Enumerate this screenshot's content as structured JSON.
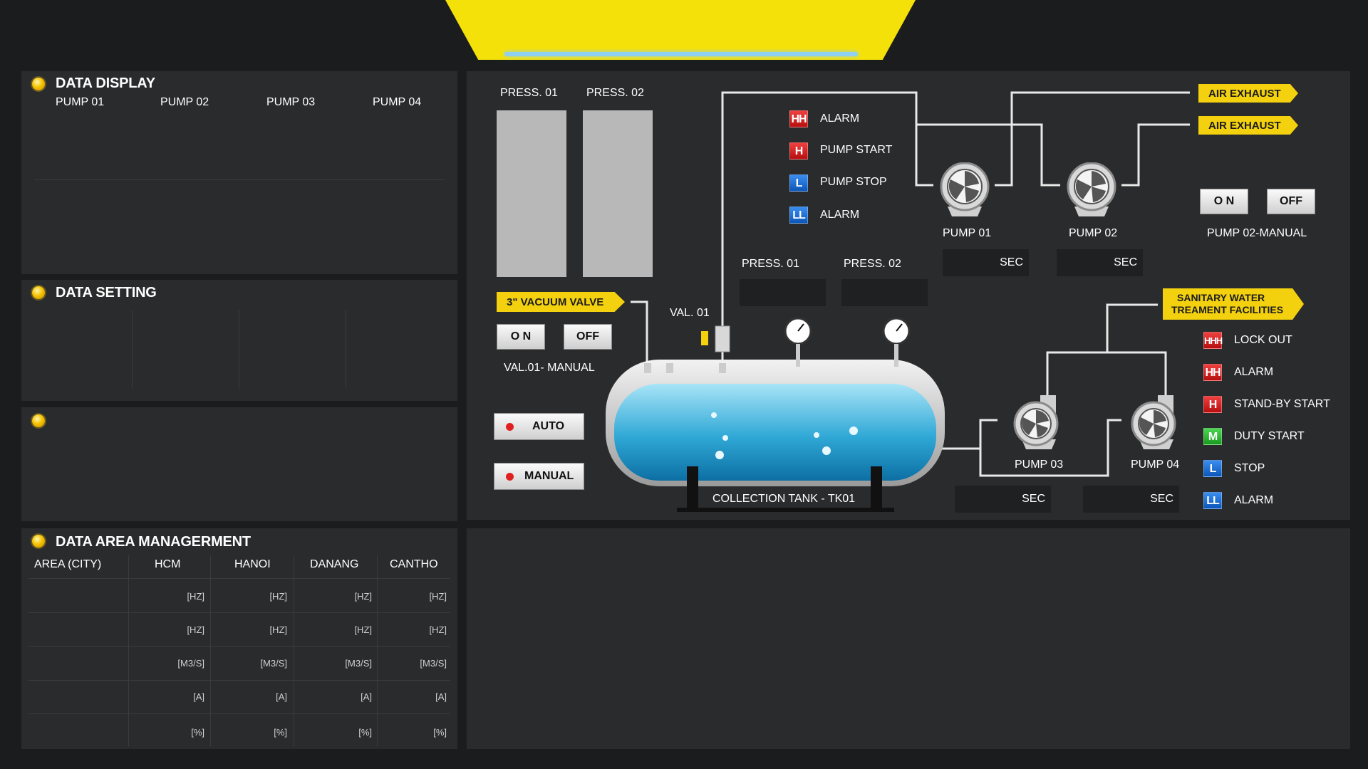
{
  "data_display": {
    "title": "DATA DISPLAY",
    "columns": [
      "PUMP 01",
      "PUMP 02",
      "PUMP 03",
      "PUMP 04"
    ]
  },
  "data_setting": {
    "title": "DATA SETTING"
  },
  "data_area": {
    "title": "DATA AREA MANAGERMENT",
    "header": [
      "AREA (CITY)",
      "HCM",
      "HANOI",
      "DANANG",
      "CANTHO"
    ],
    "rows": [
      [
        "[HZ]",
        "[HZ]",
        "[HZ]",
        "[HZ]"
      ],
      [
        "[HZ]",
        "[HZ]",
        "[HZ]",
        "[HZ]"
      ],
      [
        "[M3/S]",
        "[M3/S]",
        "[M3/S]",
        "[M3/S]"
      ],
      [
        "[A]",
        "[A]",
        "[A]",
        "[A]"
      ],
      [
        "[%]",
        "[%]",
        "[%]",
        "[%]"
      ]
    ]
  },
  "process": {
    "press_bars": [
      "PRESS. 01",
      "PRESS. 02"
    ],
    "vacuum_valve_tag": "3\" VACUUM VALVE",
    "val_on": "O N",
    "val_off": "OFF",
    "val_manual": "VAL.01- MANUAL",
    "val_label": "VAL. 01",
    "auto": "AUTO",
    "manual": "MANUAL",
    "tank_label": "COLLECTION TANK - TK01",
    "press_readouts": [
      "PRESS. 01",
      "PRESS. 02"
    ],
    "level_legend": [
      {
        "code": "HH",
        "label": "ALARM",
        "color": "red"
      },
      {
        "code": "H",
        "label": "PUMP START",
        "color": "red"
      },
      {
        "code": "L",
        "label": "PUMP STOP",
        "color": "blue"
      },
      {
        "code": "LL",
        "label": "ALARM",
        "color": "blue"
      }
    ],
    "air_exhaust_1": "AIR EXHAUST",
    "air_exhaust_2": "AIR EXHAUST",
    "pump01": "PUMP 01",
    "pump02": "PUMP 02",
    "pump03": "PUMP 03",
    "pump04": "PUMP 04",
    "sec": "SEC",
    "pump02_on": "O N",
    "pump02_off": "OFF",
    "pump02_manual": "PUMP 02-MANUAL",
    "sanitary_tag_line1": "SANITARY WATER",
    "sanitary_tag_line2": "TREAMENT FACILITIES",
    "sanitary_legend": [
      {
        "code": "HHH",
        "label": "LOCK OUT",
        "color": "red"
      },
      {
        "code": "HH",
        "label": "ALARM",
        "color": "red"
      },
      {
        "code": "H",
        "label": "STAND-BY START",
        "color": "red"
      },
      {
        "code": "M",
        "label": "DUTY START",
        "color": "green"
      },
      {
        "code": "L",
        "label": "STOP",
        "color": "blue"
      },
      {
        "code": "LL",
        "label": "ALARM",
        "color": "blue"
      }
    ]
  },
  "colors": {
    "accent_yellow": "#f3d10f",
    "panel": "#2a2b2c",
    "background": "#1b1c1d",
    "water": "#2fa8d6"
  }
}
